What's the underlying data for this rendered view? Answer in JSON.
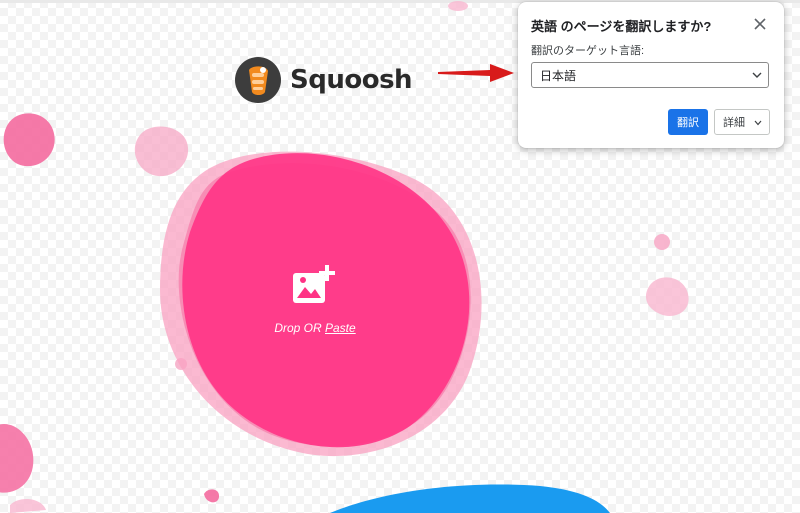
{
  "logo": {
    "name": "Squoosh",
    "icon": "squoosh-logo-icon"
  },
  "drop": {
    "text": "Drop OR ",
    "paste_label": "Paste",
    "icon": "add-image-icon"
  },
  "translate_popup": {
    "title": "英語 のページを翻訳しますか?",
    "label": "翻訳のターゲット言語:",
    "selected_language": "日本語",
    "translate_button": "翻訳",
    "details_button": "詳細",
    "close_icon": "close-icon"
  },
  "colors": {
    "blob": "#ff3385",
    "blob_light": "#f9a1c2",
    "accent_blue": "#1a9bf0",
    "button_blue": "#1a73e8",
    "arrow_red": "#d81b1b"
  }
}
